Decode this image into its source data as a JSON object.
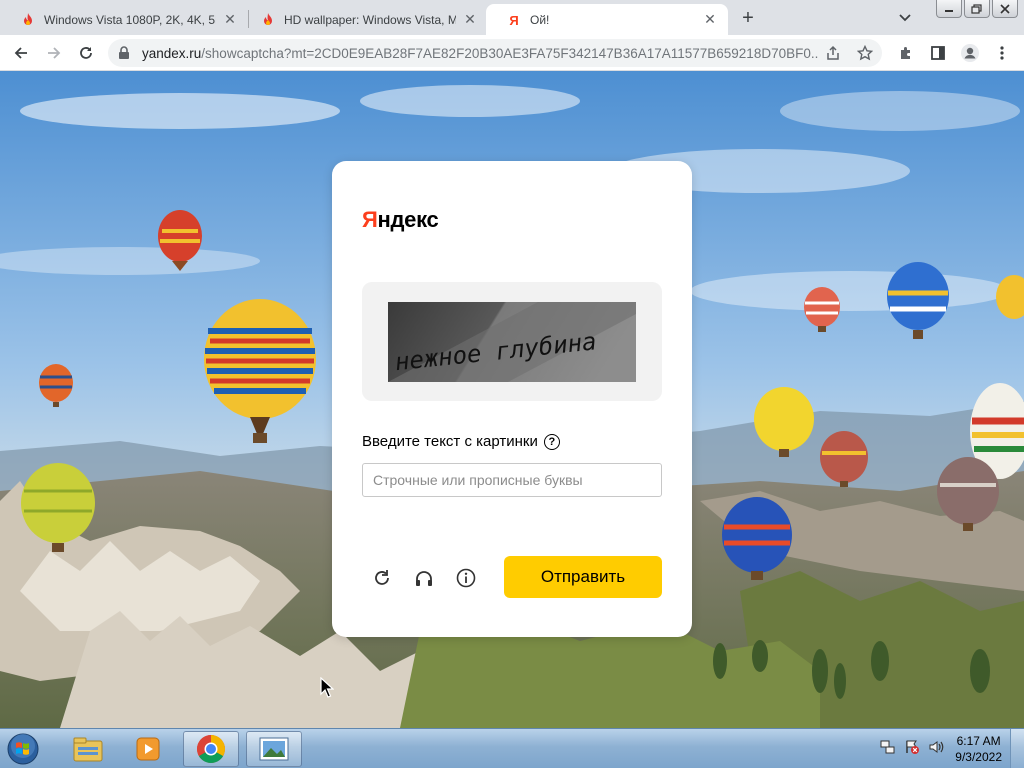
{
  "tabs": [
    {
      "title": "Windows Vista 1080P, 2K, 4K, 5K",
      "favicon": "flame-icon",
      "active": false
    },
    {
      "title": "HD wallpaper: Windows Vista, M",
      "favicon": "flame-icon",
      "active": false
    },
    {
      "title": "Ой!",
      "favicon": "yandex-icon",
      "active": true
    }
  ],
  "address_bar": {
    "host": "yandex.ru",
    "path": "/showcaptcha?mt=2CD0E9EAB28F7AE82F20B30AE3FA75F342147B36A17A11577B659218D70BF0..."
  },
  "captcha": {
    "brand_first": "Я",
    "brand_rest": "ндекс",
    "captcha_text": "нежное глубина",
    "prompt": "Введите текст с картинки",
    "help_symbol": "?",
    "input_value": "",
    "input_placeholder": "Строчные или прописные буквы",
    "submit_label": "Отправить",
    "controls": [
      "refresh-icon",
      "audio-icon",
      "info-icon"
    ]
  },
  "taskbar": {
    "apps": [
      "explorer-icon",
      "media-player-icon",
      "chrome-icon",
      "photo-viewer-icon"
    ],
    "time": "6:17 AM",
    "date": "9/3/2022"
  },
  "colors": {
    "brand_red": "#fc3f1d",
    "submit_yellow": "#ffcc00"
  }
}
